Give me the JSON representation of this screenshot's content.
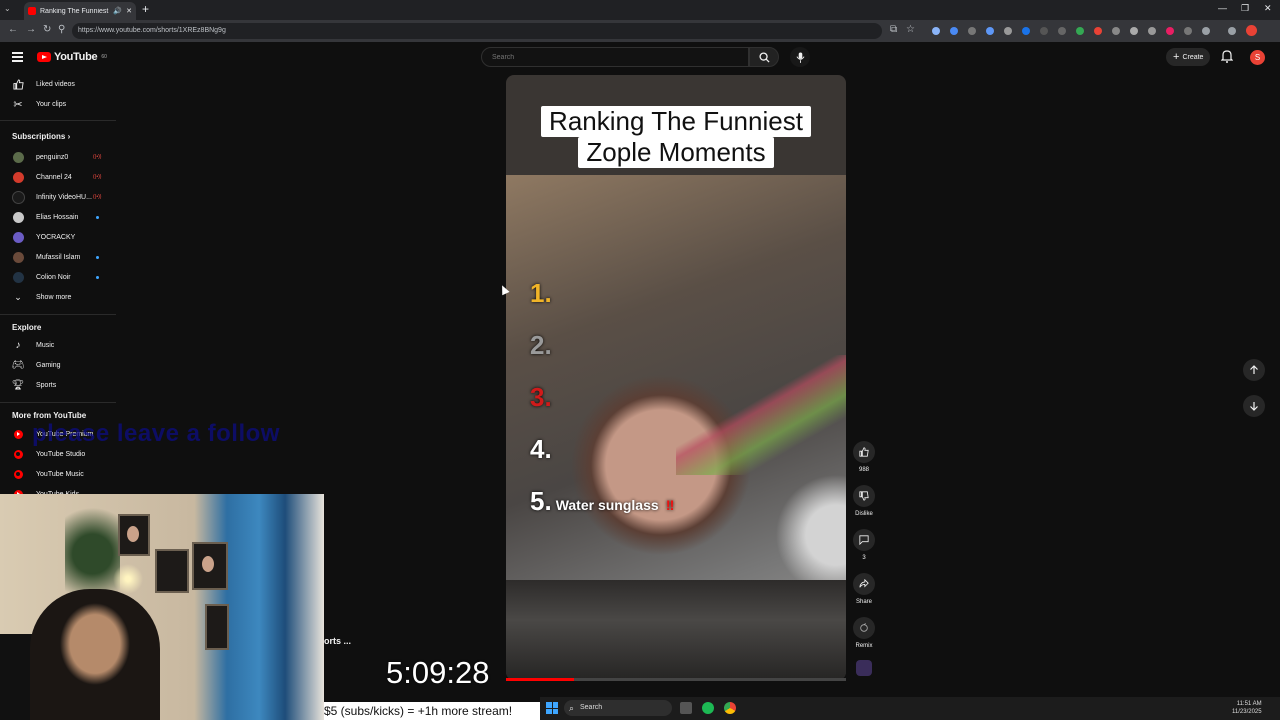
{
  "browser": {
    "tab_title": "Ranking The Funniest Zople",
    "url": "https://www.youtube.com/shorts/1XREz8BNg9g"
  },
  "header": {
    "logo_text": "YouTube",
    "logo_badge": "60",
    "search_placeholder": "Search",
    "create_label": "Create",
    "avatar_letter": "S"
  },
  "sidebar": {
    "top_items": [
      {
        "label": "Liked videos",
        "icon": "thumbs-up-icon"
      },
      {
        "label": "Your clips",
        "icon": "scissors-icon"
      }
    ],
    "subscriptions_title": "Subscriptions",
    "subscriptions": [
      {
        "label": "penguinz0",
        "status": "live",
        "color": "#5b6b4a"
      },
      {
        "label": "Channel 24",
        "status": "live",
        "color": "#d33b2c"
      },
      {
        "label": "Infinity VideoHU...",
        "status": "live",
        "color": "#1a1a1a"
      },
      {
        "label": "Elias Hossain",
        "status": "new",
        "color": "#c9c9c9"
      },
      {
        "label": "YOCRACKY",
        "status": "",
        "color": "#6b5cc4"
      },
      {
        "label": "Mufassil Islam",
        "status": "new",
        "color": "#6a4a3a"
      },
      {
        "label": "Colion Noir",
        "status": "new",
        "color": "#223344"
      }
    ],
    "show_more": "Show more",
    "explore_title": "Explore",
    "explore": [
      {
        "label": "Music",
        "icon": "music-note-icon"
      },
      {
        "label": "Gaming",
        "icon": "gamepad-icon"
      },
      {
        "label": "Sports",
        "icon": "trophy-icon"
      }
    ],
    "more_title": "More from YouTube",
    "more": [
      {
        "label": "YouTube Premium"
      },
      {
        "label": "YouTube Studio"
      },
      {
        "label": "YouTube Music"
      },
      {
        "label": "YouTube Kids"
      }
    ]
  },
  "overlay_text": "please leave a follow",
  "short": {
    "title_line1": "Ranking The Funniest",
    "title_line2": "Zople Moments",
    "ranks": [
      {
        "num": "1.",
        "color": "#f0b428",
        "text": ""
      },
      {
        "num": "2.",
        "color": "#9a9a9a",
        "text": ""
      },
      {
        "num": "3.",
        "color": "#d11a1a",
        "text": ""
      },
      {
        "num": "4.",
        "color": "#ffffff",
        "text": ""
      },
      {
        "num": "5.",
        "color": "#ffffff",
        "text": "Water sunglass",
        "mark": "‼"
      }
    ],
    "progress_fraction": 0.2
  },
  "actions": {
    "like_count": "988",
    "dislike_label": "Dislike",
    "comments_count": "3",
    "share_label": "Share",
    "remix_label": "Remix"
  },
  "stream": {
    "shorts_label": "orts ...",
    "timer": "5:09:28",
    "promo": "$5 (subs/kicks) = +1h more stream!"
  },
  "taskbar": {
    "search_label": "Search",
    "time": "11:51 AM",
    "date": "11/23/2025"
  }
}
